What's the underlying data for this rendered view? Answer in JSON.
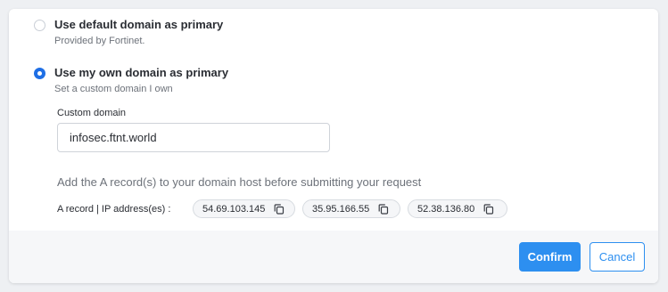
{
  "options": [
    {
      "title": "Use default domain as primary",
      "subtitle": "Provided by Fortinet.",
      "selected": false
    },
    {
      "title": "Use my own domain as primary",
      "subtitle": "Set a custom domain I own",
      "selected": true
    }
  ],
  "custom_domain": {
    "label": "Custom domain",
    "value": "infosec.ftnt.world"
  },
  "hint": "Add the A record(s) to your domain host before submitting your request",
  "a_record": {
    "label": "A record | IP address(es) :",
    "ips": [
      "54.69.103.145",
      "35.95.166.55",
      "52.38.136.80"
    ],
    "copy_icon": "copy-icon"
  },
  "footer": {
    "confirm_label": "Confirm",
    "cancel_label": "Cancel"
  },
  "colors": {
    "accent": "#2d8ff0",
    "radio_selected": "#1f6fe5"
  }
}
